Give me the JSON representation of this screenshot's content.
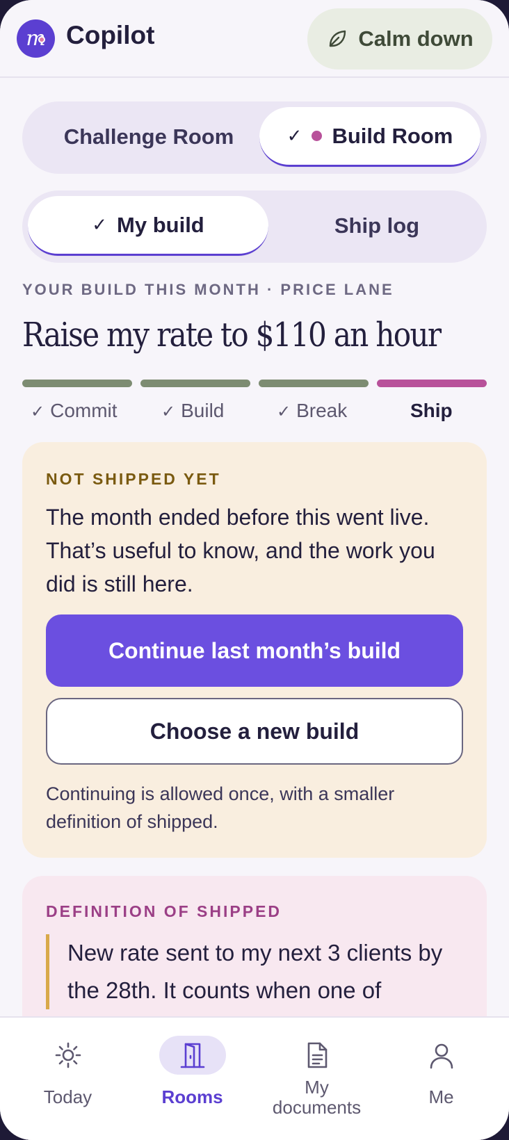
{
  "header": {
    "logo_letter": "m",
    "app_title": "Copilot",
    "calm_label": "Calm down"
  },
  "room_switch": {
    "challenge_label": "Challenge Room",
    "build_label": "Build Room",
    "selected": "Build Room"
  },
  "build_tabs": {
    "my_build_label": "My build",
    "ship_log_label": "Ship log",
    "selected": "My build"
  },
  "build": {
    "eyebrow": "YOUR BUILD THIS MONTH · PRICE LANE",
    "title": "Raise my rate to $110 an hour",
    "steps": [
      {
        "label": "Commit",
        "done": true,
        "color": "#7d8c72"
      },
      {
        "label": "Build",
        "done": true,
        "color": "#7d8c72"
      },
      {
        "label": "Break",
        "done": true,
        "color": "#7d8c72"
      },
      {
        "label": "Ship",
        "done": false,
        "current": true,
        "color": "#b8519a"
      }
    ],
    "check_glyph": "✓"
  },
  "not_shipped": {
    "label": "NOT SHIPPED YET",
    "body": "The month ended before this went live. That’s useful to know, and the work you did is still here.",
    "continue_label": "Continue last month’s build",
    "new_label": "Choose a new build",
    "note": "Continuing is allowed once, with a smaller definition of shipped."
  },
  "definition": {
    "label": "DEFINITION OF SHIPPED",
    "text": "New rate sent to my next 3 clients by the 28th. It counts when one of"
  },
  "nav": {
    "today": "Today",
    "rooms": "Rooms",
    "documents_line1": "My",
    "documents_line2": "documents",
    "me": "Me",
    "active": "Rooms"
  },
  "colors": {
    "accent": "#6b4fe0",
    "brand": "#5b3fd1",
    "ship_pink": "#b8519a",
    "done_green": "#7d8c72"
  }
}
